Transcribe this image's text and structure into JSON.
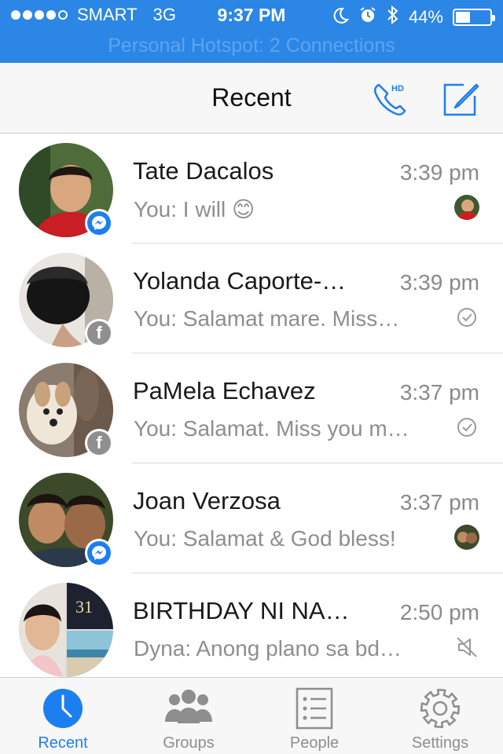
{
  "status_bar": {
    "carrier": "SMART",
    "network": "3G",
    "time": "9:37 PM",
    "battery": "44%",
    "battery_level": 0.44,
    "hotspot": "Personal Hotspot: 2 Connections"
  },
  "header": {
    "title": "Recent",
    "hd_label": "HD"
  },
  "conversations": [
    {
      "name": "Tate Dacalos",
      "time": "3:39 pm",
      "preview": "You: I will 😊",
      "badge": "messenger",
      "status": "seen-avatar"
    },
    {
      "name": "Yolanda Caporte-…",
      "time": "3:39 pm",
      "preview": "You: Salamat mare. Miss…",
      "badge": "facebook",
      "status": "delivered"
    },
    {
      "name": "PaMela Echavez",
      "time": "3:37 pm",
      "preview": "You: Salamat. Miss you m…",
      "badge": "facebook",
      "status": "delivered"
    },
    {
      "name": "Joan Verzosa",
      "time": "3:37 pm",
      "preview": "You: Salamat & God bless!",
      "badge": "messenger",
      "status": "seen-avatar"
    },
    {
      "name": "BIRTHDAY NI NA…",
      "time": "2:50 pm",
      "preview": "Dyna: Anong plano sa bd…",
      "badge": "none",
      "status": "muted"
    }
  ],
  "tabs": [
    {
      "label": "Recent",
      "icon": "clock-icon",
      "active": true
    },
    {
      "label": "Groups",
      "icon": "groups-icon",
      "active": false
    },
    {
      "label": "People",
      "icon": "list-icon",
      "active": false
    },
    {
      "label": "Settings",
      "icon": "gear-icon",
      "active": false
    }
  ],
  "colors": {
    "accent": "#1c7ff0",
    "status_bar": "#2b86e6",
    "secondary_text": "#8e8e8e"
  }
}
